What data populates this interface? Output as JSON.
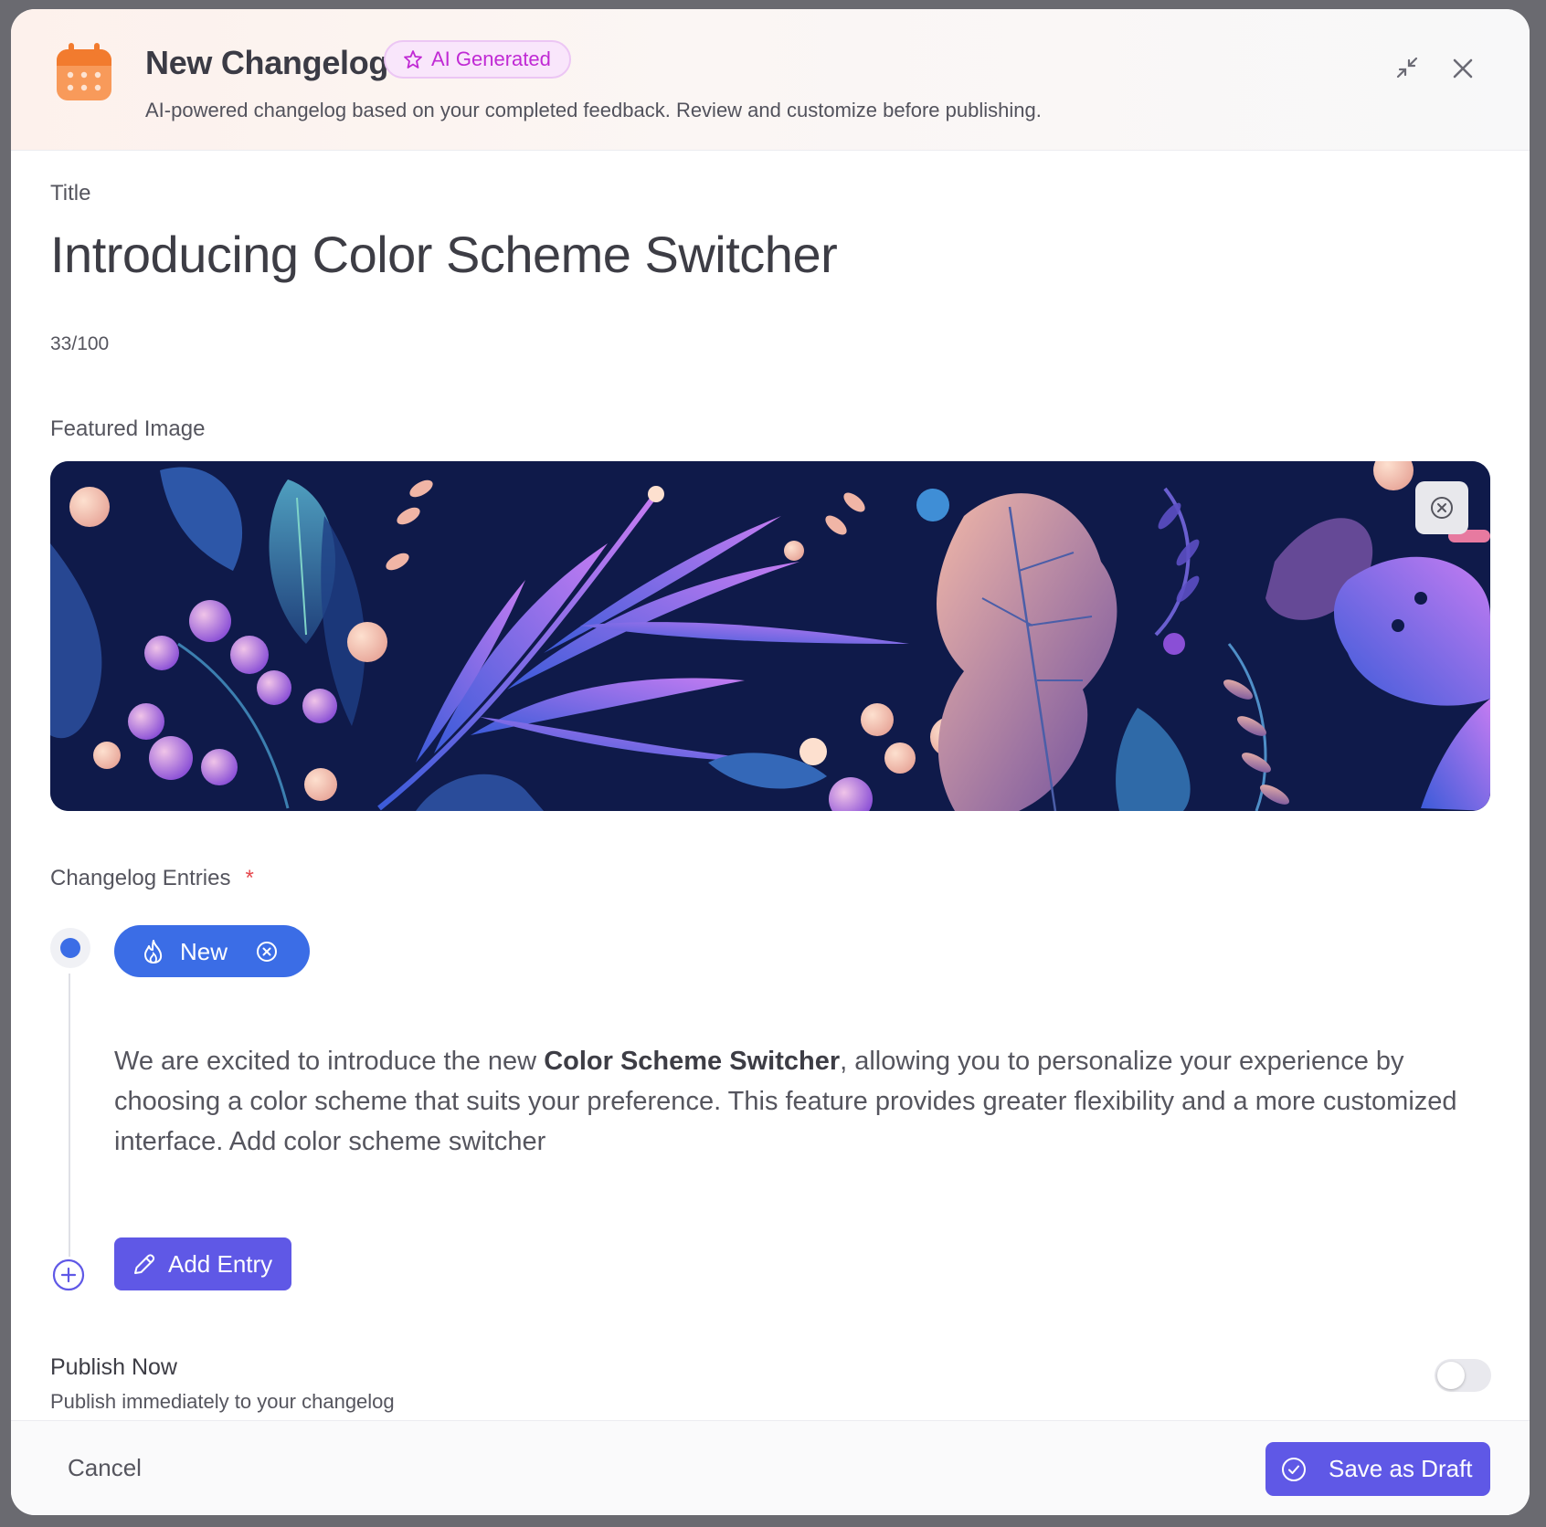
{
  "header": {
    "title": "New Changelog",
    "badge": "AI Generated",
    "subtitle": "AI-powered changelog based on your completed feedback. Review and customize before publishing.",
    "icons": {
      "app": "calendar-icon",
      "badge": "sparkle-icon",
      "collapse": "collapse-icon",
      "close": "close-icon"
    }
  },
  "form": {
    "title_label": "Title",
    "title_value": "Introducing Color Scheme Switcher",
    "title_counter": "33/100",
    "featured_label": "Featured Image",
    "entries_label": "Changelog Entries",
    "required_marker": "*",
    "entry": {
      "tag": "New",
      "text_before": "We are excited to introduce the new ",
      "text_bold": "Color Scheme Switcher",
      "text_after": ", allowing you to personalize your experience by choosing a color scheme that suits your preference. This feature provides greater flexibility and a more customized interface. Add color scheme switcher"
    },
    "add_entry_label": "Add Entry",
    "publish_label": "Publish Now",
    "publish_sub": "Publish immediately to your changelog",
    "publish_on": false
  },
  "footer": {
    "cancel_label": "Cancel",
    "save_label": "Save as Draft"
  },
  "colors": {
    "accent": "#5f58e6",
    "tag_blue": "#3b6de6",
    "badge_text": "#c02ad4",
    "calendar": "#f5883e"
  }
}
